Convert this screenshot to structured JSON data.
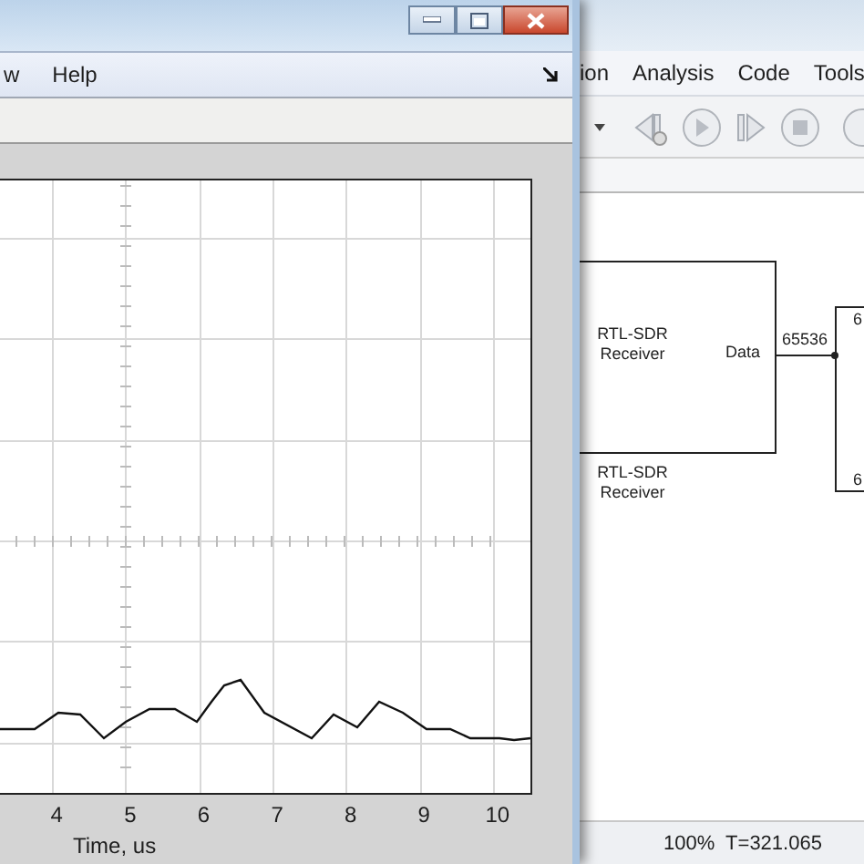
{
  "scope_window": {
    "menu": [
      {
        "label": "w"
      },
      {
        "label": "Help"
      }
    ],
    "plot": {
      "x_tick_labels": [
        "4",
        "5",
        "6",
        "7",
        "8",
        "9",
        "10"
      ],
      "xlabel": "Time, us"
    }
  },
  "model_window": {
    "menu": [
      {
        "label": "ion"
      },
      {
        "label": "Analysis"
      },
      {
        "label": "Code"
      },
      {
        "label": "Tools"
      }
    ],
    "blocks": [
      {
        "kind": "source",
        "title": "RTL-SDR Receiver",
        "port": "Data",
        "caption": "RTL-SDR Receiver"
      },
      {
        "kind": "sink",
        "top_text": "6",
        "bottom_text": "6"
      }
    ],
    "signal_label": "65536",
    "status": "100%  T=321.065"
  }
}
